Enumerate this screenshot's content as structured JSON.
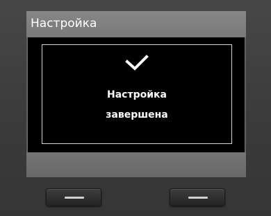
{
  "header": {
    "title": "Настройка"
  },
  "dialog": {
    "icon": "checkmark-icon",
    "message_line1": "Настройка",
    "message_line2": "завершена"
  },
  "softkeys": {
    "left_icon": "softkey-left-dash-icon",
    "right_icon": "softkey-right-dash-icon"
  },
  "colors": {
    "header_bg": "#828282",
    "content_bg": "#000000",
    "text": "#ffffff",
    "device_body": "#3a3a3a"
  }
}
